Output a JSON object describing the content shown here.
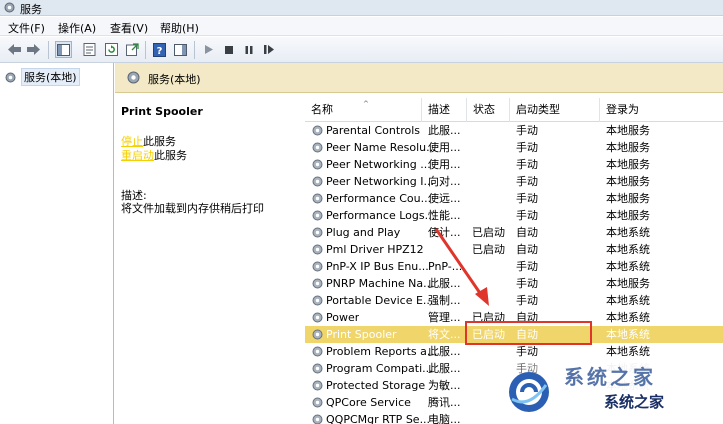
{
  "window": {
    "title": "服务"
  },
  "menu": [
    "文件(F)",
    "操作(A)",
    "查看(V)",
    "帮助(H)"
  ],
  "tree": {
    "root_label": "服务(本地)"
  },
  "header": {
    "title": "服务(本地)"
  },
  "detail": {
    "service_name": "Print Spooler",
    "action_stop_link": "停止",
    "action_stop_suffix": "此服务",
    "action_restart_link": "重启动",
    "action_restart_suffix": "此服务",
    "desc_label": "描述:",
    "desc_text": "将文件加载到内存供稍后打印"
  },
  "columns": {
    "name": "名称",
    "desc": "描述",
    "status": "状态",
    "startup": "启动类型",
    "logon": "登录为"
  },
  "rows": [
    {
      "name": "Parental Controls",
      "desc": "此服...",
      "status": "",
      "startup": "手动",
      "logon": "本地服务"
    },
    {
      "name": "Peer Name Resolu...",
      "desc": "使用...",
      "status": "",
      "startup": "手动",
      "logon": "本地服务"
    },
    {
      "name": "Peer Networking ...",
      "desc": "使用...",
      "status": "",
      "startup": "手动",
      "logon": "本地服务"
    },
    {
      "name": "Peer Networking I...",
      "desc": "向对...",
      "status": "",
      "startup": "手动",
      "logon": "本地服务"
    },
    {
      "name": "Performance Cou...",
      "desc": "使远...",
      "status": "",
      "startup": "手动",
      "logon": "本地服务"
    },
    {
      "name": "Performance Logs...",
      "desc": "性能...",
      "status": "",
      "startup": "手动",
      "logon": "本地服务"
    },
    {
      "name": "Plug and Play",
      "desc": "使计...",
      "status": "已启动",
      "startup": "自动",
      "logon": "本地系统"
    },
    {
      "name": "Pml Driver HPZ12",
      "desc": "",
      "status": "已启动",
      "startup": "自动",
      "logon": "本地系统"
    },
    {
      "name": "PnP-X IP Bus Enu...",
      "desc": "PnP-...",
      "status": "",
      "startup": "手动",
      "logon": "本地系统"
    },
    {
      "name": "PNRP Machine Na...",
      "desc": "此服...",
      "status": "",
      "startup": "手动",
      "logon": "本地服务"
    },
    {
      "name": "Portable Device E...",
      "desc": "强制...",
      "status": "",
      "startup": "手动",
      "logon": "本地系统"
    },
    {
      "name": "Power",
      "desc": "管理...",
      "status": "已启动",
      "startup": "自动",
      "logon": "本地系统"
    },
    {
      "name": "Print Spooler",
      "desc": "将文...",
      "status": "已启动",
      "startup": "自动",
      "logon": "本地系统"
    },
    {
      "name": "Problem Reports a...",
      "desc": "此服...",
      "status": "",
      "startup": "手动",
      "logon": "本地系统"
    },
    {
      "name": "Program Compati...",
      "desc": "此服...",
      "status": "",
      "startup": "手动",
      "logon": "本地系统"
    },
    {
      "name": "Protected Storage",
      "desc": "为敏...",
      "status": "",
      "startup": "手动",
      "logon": "本地系统"
    },
    {
      "name": "QPCore Service",
      "desc": "腾讯...",
      "status": "",
      "startup": "",
      "logon": ""
    },
    {
      "name": "QQPCMgr RTP Se...",
      "desc": "电脑...",
      "status": "",
      "startup": "",
      "logon": ""
    }
  ],
  "selected_row": 12,
  "watermark": {
    "text": "系统之家",
    "big_text": "系统之家"
  },
  "colors": {
    "selection": "#f0d56a",
    "annotation": "#e0352b",
    "header_bg": "#f3e9c6"
  }
}
